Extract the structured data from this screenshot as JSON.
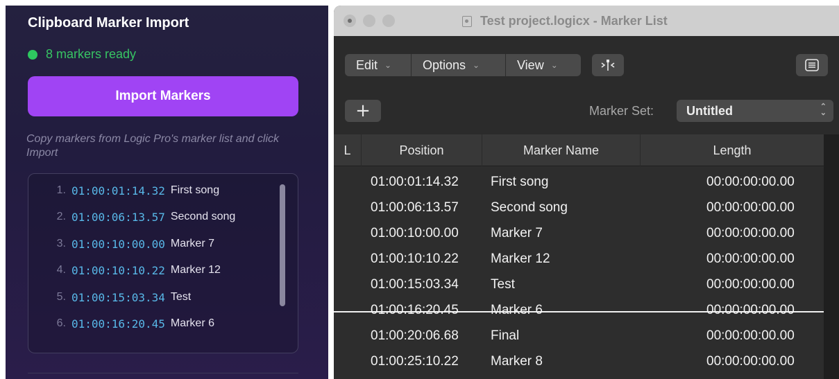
{
  "left_panel": {
    "title": "Clipboard Marker Import",
    "status_text": "8 markers ready",
    "status_color": "#2ec760",
    "import_button": "Import Markers",
    "accent_color": "#a044f4",
    "hint": "Copy markers from Logic Pro's marker list and click Import",
    "markers": [
      {
        "num": "1.",
        "timecode": "01:00:01:14.32",
        "name": "First song"
      },
      {
        "num": "2.",
        "timecode": "01:00:06:13.57",
        "name": "Second song"
      },
      {
        "num": "3.",
        "timecode": "01:00:10:00.00",
        "name": "Marker 7"
      },
      {
        "num": "4.",
        "timecode": "01:00:10:10.22",
        "name": "Marker 12"
      },
      {
        "num": "5.",
        "timecode": "01:00:15:03.34",
        "name": "Test"
      },
      {
        "num": "6.",
        "timecode": "01:00:16:20.45",
        "name": "Marker 6"
      }
    ]
  },
  "window": {
    "title": "Test project.logicx - Marker List",
    "menus": [
      {
        "label": "Edit"
      },
      {
        "label": "Options"
      },
      {
        "label": "View"
      }
    ],
    "marker_set_label": "Marker Set:",
    "marker_set_value": "Untitled",
    "columns": [
      "L",
      "Position",
      "Marker Name",
      "Length"
    ],
    "rows": [
      {
        "position": "01:00:01:14.32",
        "name": "First song",
        "length": "00:00:00:00.00",
        "struck": false
      },
      {
        "position": "01:00:06:13.57",
        "name": "Second song",
        "length": "00:00:00:00.00",
        "struck": false
      },
      {
        "position": "01:00:10:00.00",
        "name": "Marker 7",
        "length": "00:00:00:00.00",
        "struck": false
      },
      {
        "position": "01:00:10:10.22",
        "name": "Marker 12",
        "length": "00:00:00:00.00",
        "struck": false
      },
      {
        "position": "01:00:15:03.34",
        "name": "Test",
        "length": "00:00:00:00.00",
        "struck": false
      },
      {
        "position": "01:00:16:20.45",
        "name": "Marker 6",
        "length": "00:00:00:00.00",
        "struck": true
      },
      {
        "position": "01:00:20:06.68",
        "name": "Final",
        "length": "00:00:00:00.00",
        "struck": false
      },
      {
        "position": "01:00:25:10.22",
        "name": "Marker 8",
        "length": "00:00:00:00.00",
        "struck": false
      }
    ],
    "icons": {
      "add": "plus-icon",
      "snap": "marker-snap-icon",
      "list_view": "list-view-icon"
    }
  }
}
